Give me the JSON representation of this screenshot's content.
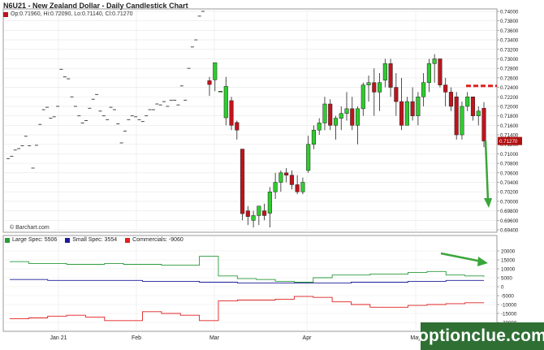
{
  "header": {
    "title": "N6U21 - New Zealand Dollar - Daily Candlestick Chart",
    "ohlc": "Op:0.71960, Hi:0.72090, Lo:0.71140, Cl:0.71270",
    "brand": "© Barchart.com",
    "watermark": "optionclue.com"
  },
  "colors": {
    "up": "#2ecc2e",
    "down": "#c0141c",
    "large_spec": "#2a9a3a",
    "small_spec": "#1c1c9a",
    "commercials": "#e02020",
    "arrow": "#3aa63a",
    "resistance": "#e02020",
    "last_price_bg": "#b01010"
  },
  "chart_data": [
    {
      "type": "candlestick",
      "title": "N6U21 - New Zealand Dollar - Daily Candlestick Chart",
      "x_labels": [
        "Jan 21",
        "Feb",
        "Mar",
        "Apr",
        "May"
      ],
      "ylim": [
        0.694,
        0.74
      ],
      "y_ticks": [
        "0.74000",
        "0.73800",
        "0.73600",
        "0.73400",
        "0.73200",
        "0.73000",
        "0.72800",
        "0.72600",
        "0.72400",
        "0.72200",
        "0.72000",
        "0.71800",
        "0.71600",
        "0.71400",
        "0.71200",
        "0.71000",
        "0.70800",
        "0.70600",
        "0.70400",
        "0.70200",
        "0.70000",
        "0.69800",
        "0.69600",
        "0.69400"
      ],
      "last_price": "0.71270",
      "resistance_level": 0.7243,
      "grid": true,
      "thin_ticks": [
        [
          0.709
        ],
        [
          0.7095
        ],
        [
          0.7108
        ],
        [
          0.7111
        ],
        [
          0.7117
        ],
        [
          0.7137
        ],
        [
          0.7117
        ],
        [
          0.707
        ],
        [
          0.7118
        ],
        [
          0.7162
        ],
        [
          0.7193
        ],
        [
          0.7198
        ],
        [
          0.7175
        ],
        [
          0.7178
        ],
        [
          0.72
        ],
        [
          0.7278
        ],
        [
          0.7262
        ],
        [
          0.7258
        ],
        [
          0.722
        ],
        [
          0.72
        ],
        [
          0.718
        ],
        [
          0.7165
        ],
        [
          0.717
        ],
        [
          0.7196
        ],
        [
          0.7215
        ],
        [
          0.7225
        ],
        [
          0.719
        ],
        [
          0.718
        ],
        [
          0.7172
        ],
        [
          0.7198
        ],
        [
          0.7193
        ],
        [
          0.7163
        ],
        [
          0.7123
        ],
        [
          0.7148
        ],
        [
          0.7172
        ],
        [
          0.718
        ],
        [
          0.7178
        ],
        [
          0.7172
        ],
        [
          0.7168
        ],
        [
          0.718
        ],
        [
          0.7193
        ],
        [
          0.7193
        ],
        [
          0.7205
        ],
        [
          0.7203
        ],
        [
          0.721
        ],
        [
          0.72
        ],
        [
          0.7213
        ],
        [
          0.7213
        ],
        [
          0.7203
        ],
        [
          0.7243
        ],
        [
          0.7213
        ],
        [
          0.728
        ],
        [
          0.7325
        ],
        [
          0.734
        ],
        [
          0.739
        ],
        [
          0.74
        ]
      ],
      "candles": [
        {
          "o": 0.7254,
          "h": 0.7262,
          "l": 0.7222,
          "c": 0.7246
        },
        {
          "o": 0.7256,
          "h": 0.728,
          "l": 0.7232,
          "c": 0.7292
        },
        {
          "o": 0.7232,
          "h": 0.7232,
          "l": 0.7232,
          "c": 0.7232
        },
        {
          "o": 0.7176,
          "h": 0.7262,
          "l": 0.716,
          "c": 0.7242
        },
        {
          "o": 0.7212,
          "h": 0.722,
          "l": 0.715,
          "c": 0.716
        },
        {
          "o": 0.7166,
          "h": 0.717,
          "l": 0.713,
          "c": 0.715
        },
        {
          "o": 0.711,
          "h": 0.711,
          "l": 0.696,
          "c": 0.6974
        },
        {
          "o": 0.698,
          "h": 0.699,
          "l": 0.695,
          "c": 0.6968
        },
        {
          "o": 0.696,
          "h": 0.698,
          "l": 0.6945,
          "c": 0.697
        },
        {
          "o": 0.697,
          "h": 0.699,
          "l": 0.695,
          "c": 0.699
        },
        {
          "o": 0.698,
          "h": 0.6995,
          "l": 0.696,
          "c": 0.697
        },
        {
          "o": 0.6975,
          "h": 0.703,
          "l": 0.6945,
          "c": 0.702
        },
        {
          "o": 0.702,
          "h": 0.706,
          "l": 0.7005,
          "c": 0.704
        },
        {
          "o": 0.704,
          "h": 0.7065,
          "l": 0.702,
          "c": 0.706
        },
        {
          "o": 0.706,
          "h": 0.707,
          "l": 0.704,
          "c": 0.7055
        },
        {
          "o": 0.7055,
          "h": 0.7065,
          "l": 0.7025,
          "c": 0.7035
        },
        {
          "o": 0.7035,
          "h": 0.7055,
          "l": 0.7015,
          "c": 0.702
        },
        {
          "o": 0.702,
          "h": 0.705,
          "l": 0.7015,
          "c": 0.704
        },
        {
          "o": 0.7065,
          "h": 0.7138,
          "l": 0.706,
          "c": 0.712
        },
        {
          "o": 0.712,
          "h": 0.716,
          "l": 0.711,
          "c": 0.715
        },
        {
          "o": 0.715,
          "h": 0.7175,
          "l": 0.714,
          "c": 0.7165
        },
        {
          "o": 0.7165,
          "h": 0.722,
          "l": 0.715,
          "c": 0.7205
        },
        {
          "o": 0.7205,
          "h": 0.7215,
          "l": 0.715,
          "c": 0.716
        },
        {
          "o": 0.716,
          "h": 0.718,
          "l": 0.713,
          "c": 0.7175
        },
        {
          "o": 0.7175,
          "h": 0.72,
          "l": 0.715,
          "c": 0.7185
        },
        {
          "o": 0.7185,
          "h": 0.723,
          "l": 0.717,
          "c": 0.7195
        },
        {
          "o": 0.7195,
          "h": 0.722,
          "l": 0.715,
          "c": 0.716
        },
        {
          "o": 0.716,
          "h": 0.72,
          "l": 0.712,
          "c": 0.7195
        },
        {
          "o": 0.7195,
          "h": 0.725,
          "l": 0.718,
          "c": 0.7245
        },
        {
          "o": 0.7245,
          "h": 0.7265,
          "l": 0.721,
          "c": 0.725
        },
        {
          "o": 0.725,
          "h": 0.728,
          "l": 0.718,
          "c": 0.723
        },
        {
          "o": 0.723,
          "h": 0.727,
          "l": 0.719,
          "c": 0.725
        },
        {
          "o": 0.7255,
          "h": 0.73,
          "l": 0.724,
          "c": 0.729
        },
        {
          "o": 0.729,
          "h": 0.73,
          "l": 0.722,
          "c": 0.724
        },
        {
          "o": 0.724,
          "h": 0.727,
          "l": 0.718,
          "c": 0.721
        },
        {
          "o": 0.721,
          "h": 0.726,
          "l": 0.715,
          "c": 0.716
        },
        {
          "o": 0.716,
          "h": 0.722,
          "l": 0.716,
          "c": 0.721
        },
        {
          "o": 0.721,
          "h": 0.724,
          "l": 0.717,
          "c": 0.718
        },
        {
          "o": 0.718,
          "h": 0.723,
          "l": 0.716,
          "c": 0.722
        },
        {
          "o": 0.722,
          "h": 0.727,
          "l": 0.72,
          "c": 0.725
        },
        {
          "o": 0.725,
          "h": 0.73,
          "l": 0.723,
          "c": 0.729
        },
        {
          "o": 0.729,
          "h": 0.731,
          "l": 0.725,
          "c": 0.73
        },
        {
          "o": 0.73,
          "h": 0.73,
          "l": 0.724,
          "c": 0.7245
        },
        {
          "o": 0.7245,
          "h": 0.726,
          "l": 0.72,
          "c": 0.723
        },
        {
          "o": 0.723,
          "h": 0.724,
          "l": 0.719,
          "c": 0.72
        },
        {
          "o": 0.722,
          "h": 0.723,
          "l": 0.713,
          "c": 0.714
        },
        {
          "o": 0.714,
          "h": 0.721,
          "l": 0.713,
          "c": 0.72
        },
        {
          "o": 0.72,
          "h": 0.723,
          "l": 0.719,
          "c": 0.722
        },
        {
          "o": 0.722,
          "h": 0.722,
          "l": 0.717,
          "c": 0.718
        },
        {
          "o": 0.718,
          "h": 0.72,
          "l": 0.716,
          "c": 0.719
        },
        {
          "o": 0.7196,
          "h": 0.7209,
          "l": 0.7114,
          "c": 0.7127
        }
      ]
    },
    {
      "type": "line",
      "title": "Commitments of Traders",
      "ylim": [
        -25000,
        25000
      ],
      "y_ticks": [
        "20000",
        "15000",
        "10000",
        "5000",
        "0",
        "-5000",
        "-10000",
        "-15000",
        "-20000"
      ],
      "series": [
        {
          "name": "Large Spec: 5506",
          "values": [
            14000,
            13000,
            13000,
            12500,
            12500,
            13000,
            12500,
            12500,
            12000,
            12000,
            17000,
            6000,
            4500,
            4000,
            3000,
            2500,
            5000,
            6500,
            6500,
            7000,
            7000,
            8000,
            8500,
            6500,
            6000,
            5500
          ]
        },
        {
          "name": "Small Spec: 3554",
          "values": [
            4000,
            4000,
            3500,
            3500,
            3500,
            3500,
            3500,
            3000,
            3000,
            3000,
            2500,
            2500,
            2000,
            2000,
            2000,
            2000,
            2000,
            2000,
            2500,
            2500,
            2500,
            3000,
            3000,
            3500,
            3500,
            3500
          ]
        },
        {
          "name": "Commercials: -9060",
          "values": [
            -18000,
            -17500,
            -16500,
            -16000,
            -17000,
            -19000,
            -19000,
            -14000,
            -15000,
            -16000,
            -19000,
            -8000,
            -7500,
            -7500,
            -7000,
            -5500,
            -6000,
            -8500,
            -10000,
            -11500,
            -11500,
            -10500,
            -10000,
            -9500,
            -9000,
            -9000
          ]
        }
      ]
    }
  ]
}
